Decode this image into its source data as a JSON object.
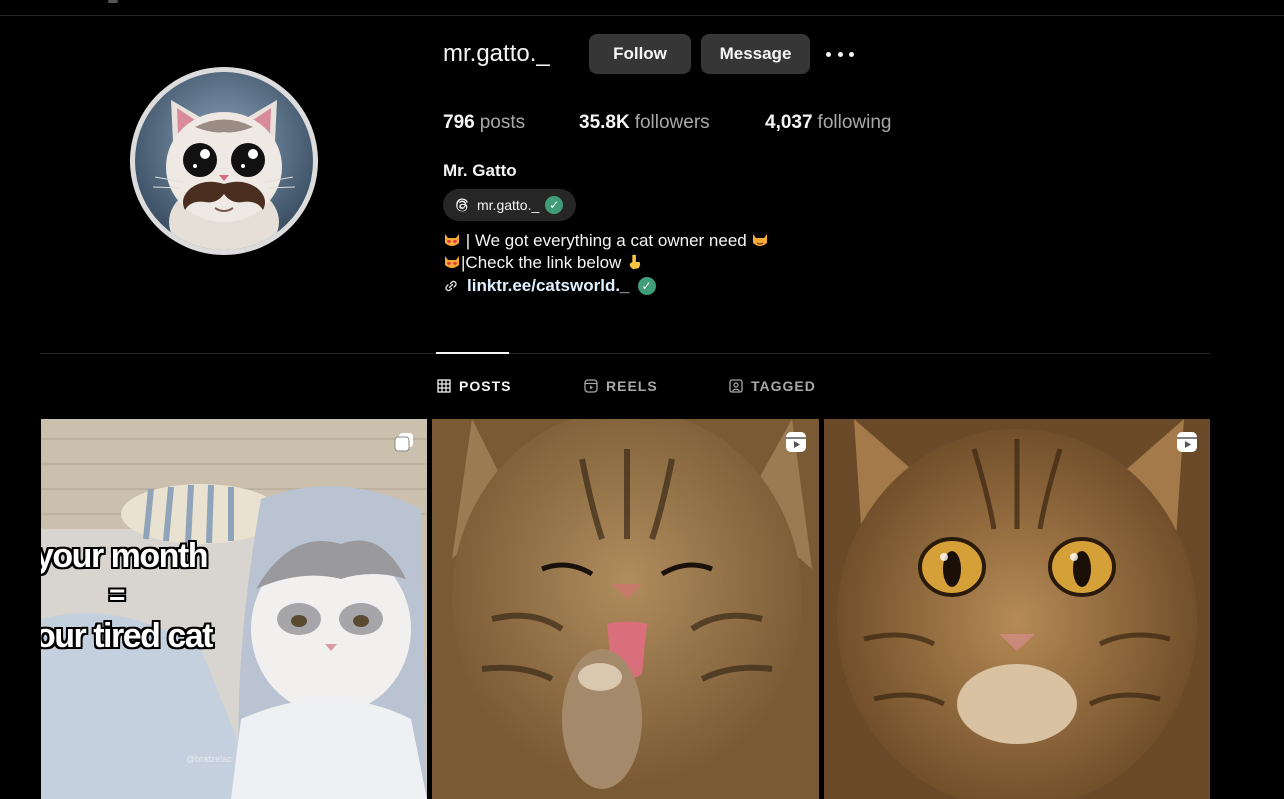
{
  "profile": {
    "username": "mr.gatto._",
    "display_name": "Mr. Gatto",
    "threads_handle": "mr.gatto._",
    "actions": {
      "follow": "Follow",
      "message": "Message"
    },
    "stats": {
      "posts_count": "796",
      "posts_label": "posts",
      "followers_count": "35.8K",
      "followers_label": "followers",
      "following_count": "4,037",
      "following_label": "following"
    },
    "bio": {
      "line1": "| We got everything a cat owner need",
      "line2": "|Check the link below",
      "link": "linktr.ee/catsworld._"
    }
  },
  "tabs": [
    {
      "label": "POSTS",
      "active": true
    },
    {
      "label": "REELS",
      "active": false
    },
    {
      "label": "TAGGED",
      "active": false
    }
  ],
  "posts": [
    {
      "type": "carousel",
      "overlay_lines": [
        "your month",
        "=",
        "our tired cat"
      ],
      "watermark": "@bratzelac"
    },
    {
      "type": "reel"
    },
    {
      "type": "reel"
    }
  ],
  "colors": {
    "background": "#000000",
    "button": "#363636",
    "verified": "#3f9d7a",
    "link": "#e0f1ff",
    "muted": "#a8a8a8"
  },
  "icons": [
    "more-icon",
    "threads-icon",
    "verified-icon",
    "link-icon",
    "grid-icon",
    "reels-icon",
    "tagged-icon",
    "carousel-icon",
    "reel-badge-icon"
  ]
}
